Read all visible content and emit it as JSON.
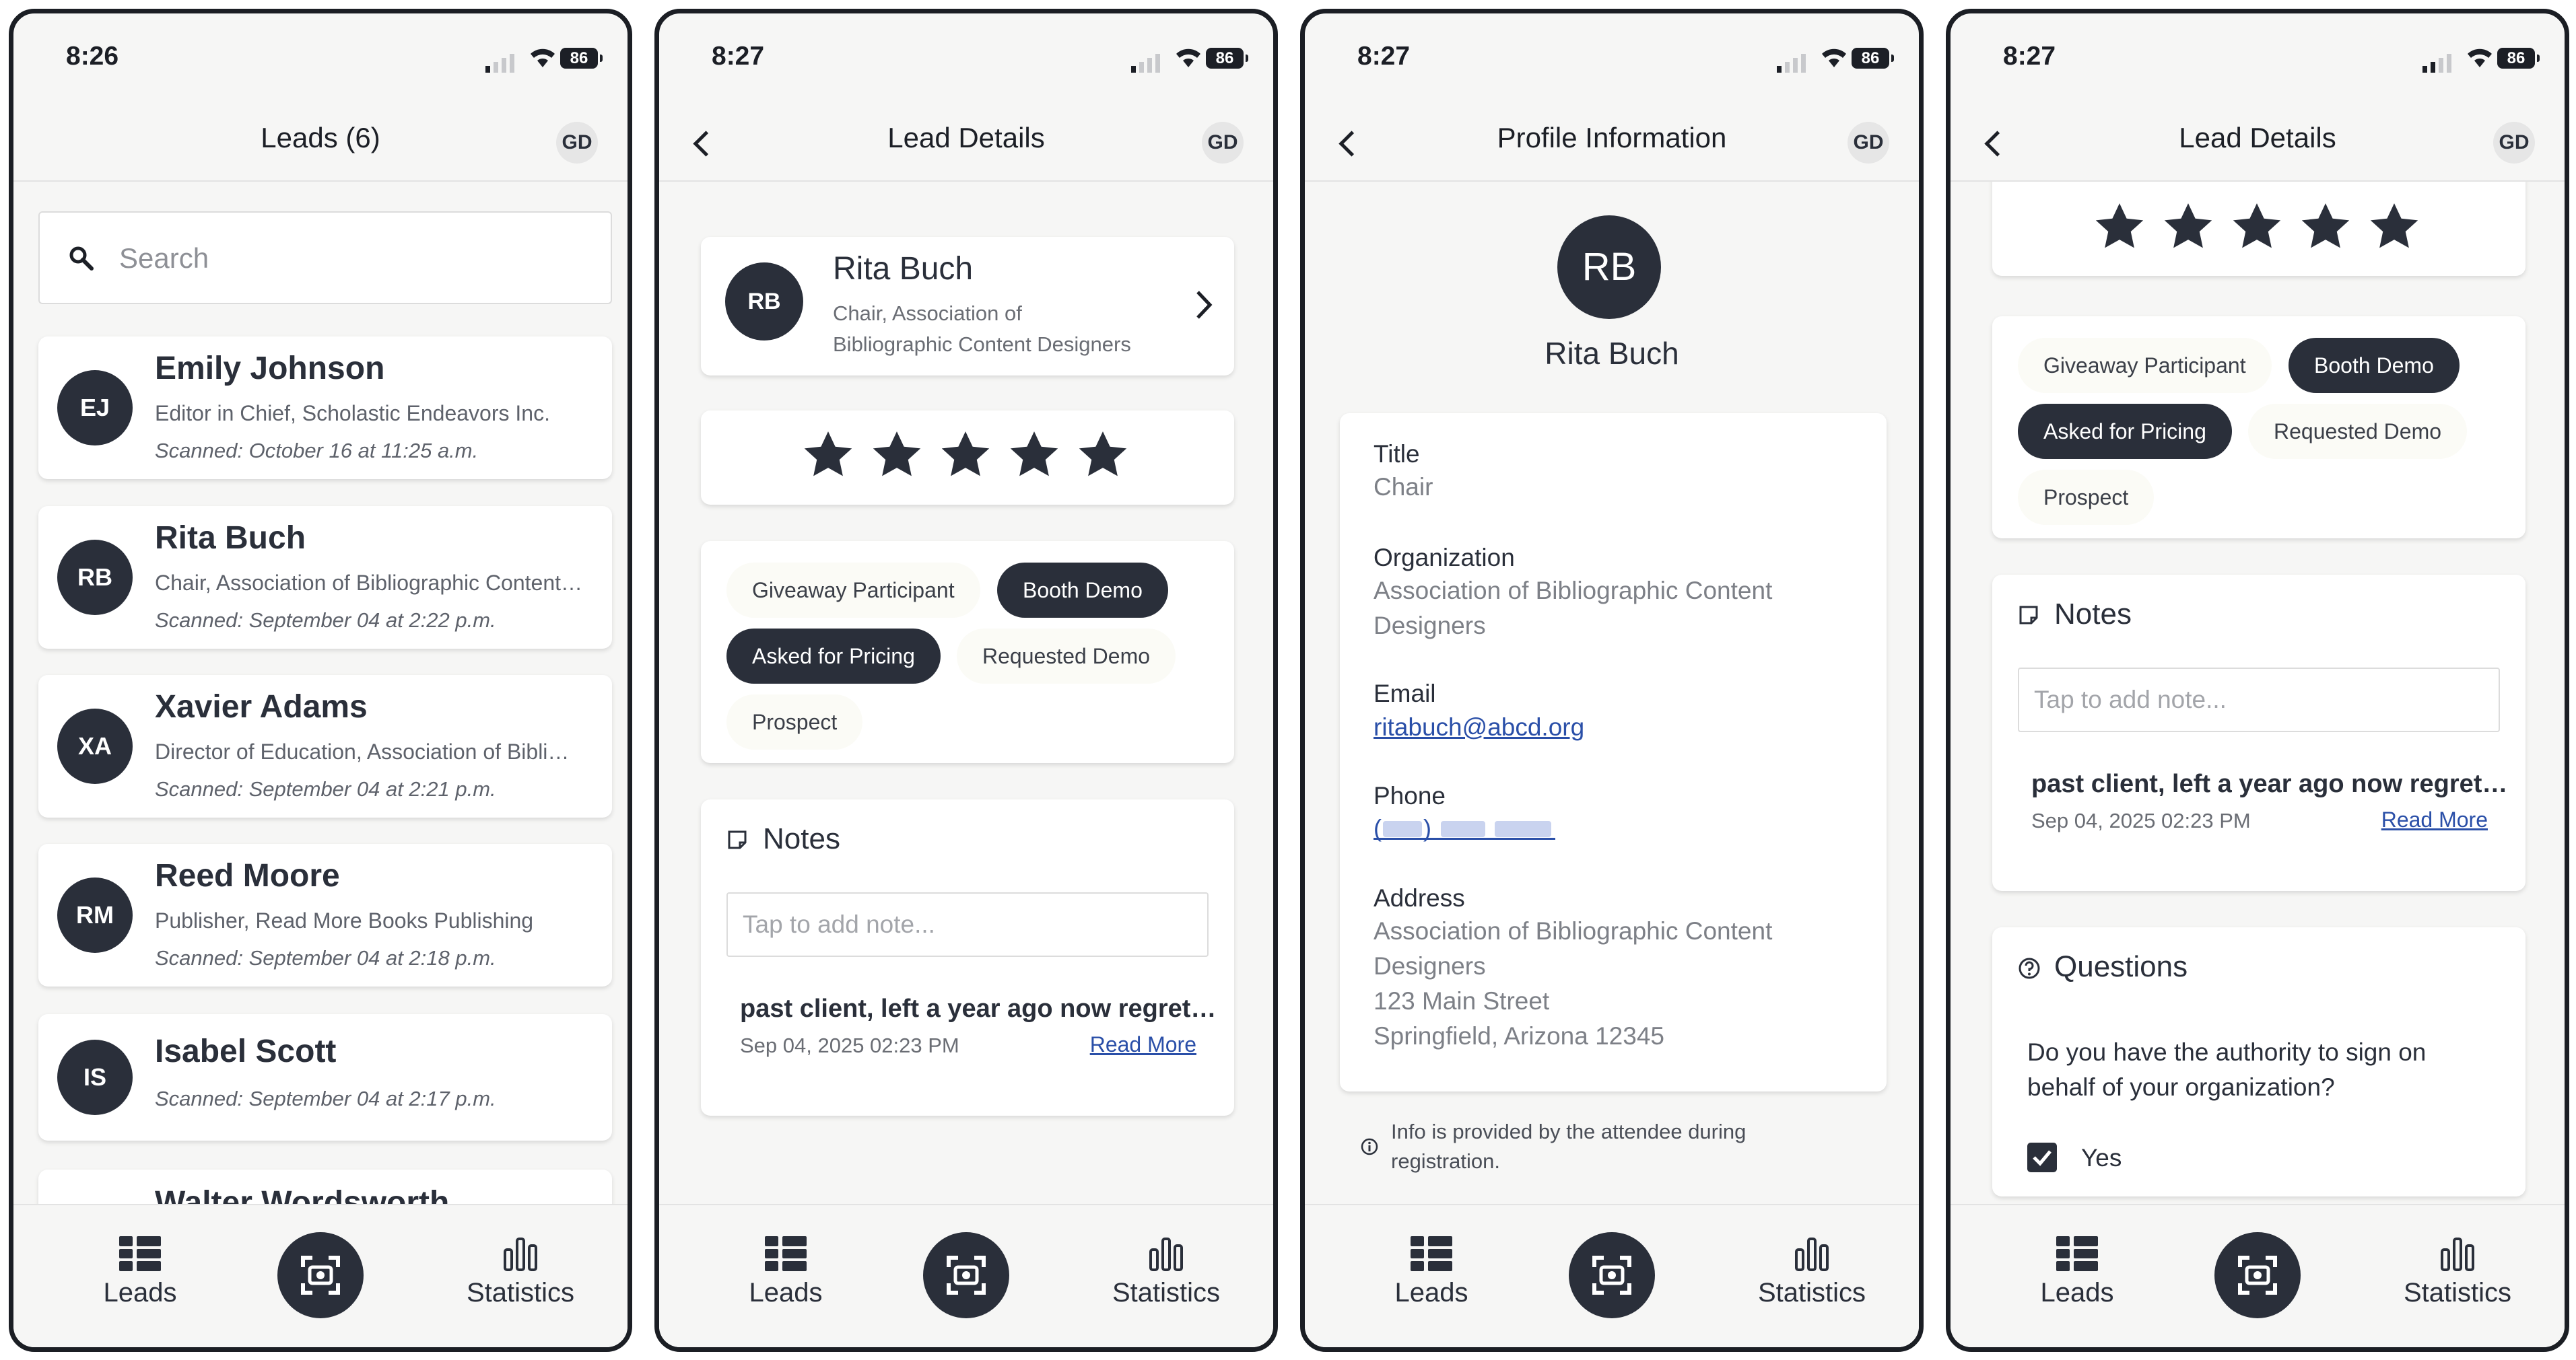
{
  "colors": {
    "primary": "#2a2f3a",
    "link": "#2a4fa8",
    "chip_bg": "#fbfbf6",
    "background": "#f6f6f5"
  },
  "status_bar": {
    "battery": "86"
  },
  "screens": [
    {
      "time": "8:26",
      "header_title": "Leads (6)",
      "avatar": "GD",
      "search_placeholder": "Search",
      "leads": [
        {
          "initials": "EJ",
          "name": "Emily Johnson",
          "title": "Editor in Chief, Scholastic Endeavors Inc.",
          "scanned": "Scanned: October 16 at 11:25 a.m."
        },
        {
          "initials": "RB",
          "name": "Rita Buch",
          "title": "Chair, Association of Bibliographic Content…",
          "scanned": "Scanned: September 04 at 2:22 p.m."
        },
        {
          "initials": "XA",
          "name": "Xavier Adams",
          "title": "Director of Education, Association of Bibli…",
          "scanned": "Scanned: September 04 at 2:21 p.m."
        },
        {
          "initials": "RM",
          "name": "Reed Moore",
          "title": "Publisher, Read More Books Publishing",
          "scanned": "Scanned: September 04 at 2:18 p.m."
        },
        {
          "initials": "IS",
          "name": "Isabel Scott",
          "title": "",
          "scanned": "Scanned: September 04 at 2:17 p.m."
        },
        {
          "initials": "",
          "name": "Walter Wordsworth",
          "title": "",
          "scanned": ""
        }
      ]
    },
    {
      "time": "8:27",
      "header_title": "Lead Details",
      "avatar": "GD",
      "lead": {
        "initials": "RB",
        "name": "Rita Buch",
        "title_line1": "Chair, Association of",
        "title_line2": "Bibliographic Content Designers"
      },
      "rating": 5
    },
    {
      "time": "8:27",
      "header_title": "Profile Information",
      "avatar": "GD",
      "profile": {
        "initials": "RB",
        "name": "Rita Buch",
        "title_label": "Title",
        "title_value": "Chair",
        "org_label": "Organization",
        "org_line1": "Association of Bibliographic Content",
        "org_line2": "Designers",
        "email_label": "Email",
        "email_value": "ritabuch@abcd.org",
        "phone_label": "Phone",
        "address_label": "Address",
        "address_line1": "Association of Bibliographic Content",
        "address_line2": "Designers",
        "address_line3": "123 Main Street",
        "address_line4": "Springfield, Arizona 12345",
        "info_line1": "Info is provided by the attendee during",
        "info_line2": "registration."
      }
    },
    {
      "time": "8:27",
      "header_title": "Lead Details",
      "avatar": "GD",
      "rating": 5,
      "questions": {
        "title": "Questions",
        "question_line1": "Do you have the authority to sign on",
        "question_line2": "behalf of your organization?",
        "answer": "Yes",
        "answer_checked": true
      }
    }
  ],
  "tags": [
    {
      "label": "Giveaway Participant",
      "selected": false
    },
    {
      "label": "Booth Demo",
      "selected": true
    },
    {
      "label": "Asked for Pricing",
      "selected": true
    },
    {
      "label": "Requested Demo",
      "selected": false
    },
    {
      "label": "Prospect",
      "selected": false
    }
  ],
  "notes": {
    "title": "Notes",
    "placeholder": "Tap to add note...",
    "items": [
      {
        "text": "past client, left a year ago now regret…",
        "date": "Sep 04, 2025 02:23 PM",
        "read_more": "Read More"
      }
    ]
  },
  "nav": {
    "leads": "Leads",
    "statistics": "Statistics"
  }
}
